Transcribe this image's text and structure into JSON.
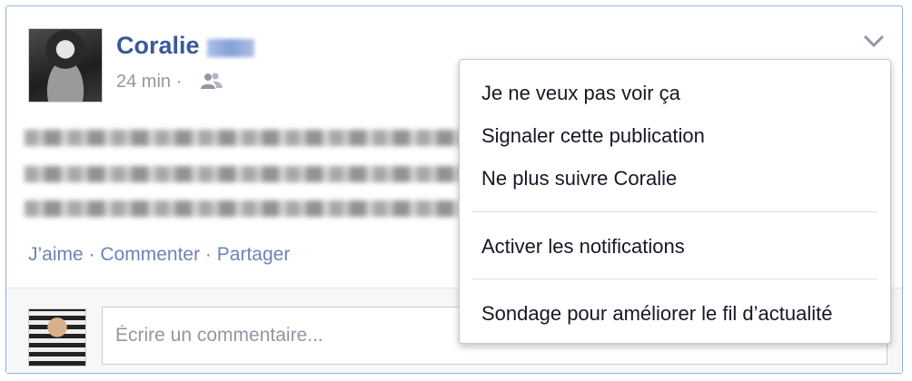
{
  "post": {
    "author_name": "Coralie",
    "time": "24 min",
    "separator": "·",
    "audience_icon": "friends-icon",
    "menu_icon": "chevron-down-icon"
  },
  "actions": {
    "like": "J’aime",
    "comment": "Commenter",
    "share": "Partager",
    "separator": "·"
  },
  "comment": {
    "placeholder": "Écrire un commentaire..."
  },
  "dropdown": {
    "items": [
      "Je ne veux pas voir ça",
      "Signaler cette publication",
      "Ne plus suivre Coralie",
      "Activer les notifications",
      "Sondage pour améliorer le fil d’actualité"
    ]
  },
  "colors": {
    "link": "#3b5998",
    "action": "#6d84b4",
    "meta": "#9197a3",
    "border": "#8fb0e6"
  }
}
